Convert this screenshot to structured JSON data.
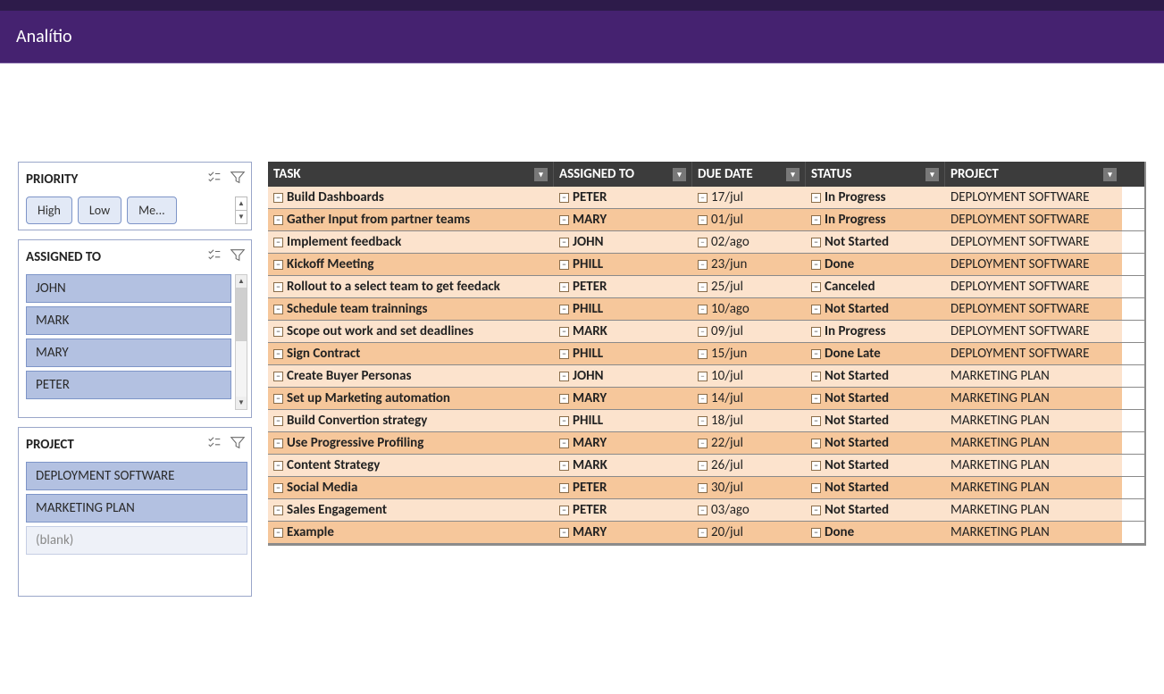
{
  "header": {
    "title": "Analítio"
  },
  "slicers": {
    "priority": {
      "title": "PRIORITY",
      "items": [
        "High",
        "Low",
        "Me..."
      ]
    },
    "assigned": {
      "title": "ASSIGNED TO",
      "items": [
        "JOHN",
        "MARK",
        "MARY",
        "PETER"
      ]
    },
    "project": {
      "title": "PROJECT",
      "items": [
        "DEPLOYMENT SOFTWARE",
        "MARKETING PLAN"
      ],
      "blank": "(blank)"
    }
  },
  "table": {
    "columns": [
      "TASK",
      "ASSIGNED TO",
      "DUE DATE",
      "STATUS",
      "PROJECT"
    ],
    "rows": [
      {
        "task": "Build Dashboards",
        "assigned": "PETER",
        "due": "17/jul",
        "status": "In Progress",
        "project": "DEPLOYMENT SOFTWARE"
      },
      {
        "task": "Gather Input from partner teams",
        "assigned": "MARY",
        "due": "01/jul",
        "status": "In Progress",
        "project": "DEPLOYMENT SOFTWARE"
      },
      {
        "task": "Implement feedback",
        "assigned": "JOHN",
        "due": "02/ago",
        "status": "Not Started",
        "project": "DEPLOYMENT SOFTWARE"
      },
      {
        "task": "Kickoff Meeting",
        "assigned": "PHILL",
        "due": "23/jun",
        "status": "Done",
        "project": "DEPLOYMENT SOFTWARE"
      },
      {
        "task": "Rollout to a select team to get feedack",
        "assigned": "PETER",
        "due": "25/jul",
        "status": "Canceled",
        "project": "DEPLOYMENT SOFTWARE"
      },
      {
        "task": "Schedule team trainnings",
        "assigned": "PHILL",
        "due": "10/ago",
        "status": "Not Started",
        "project": "DEPLOYMENT SOFTWARE"
      },
      {
        "task": "Scope out work and set deadlines",
        "assigned": "MARK",
        "due": "09/jul",
        "status": "In Progress",
        "project": "DEPLOYMENT SOFTWARE"
      },
      {
        "task": "Sign Contract",
        "assigned": "PHILL",
        "due": "15/jun",
        "status": "Done Late",
        "project": "DEPLOYMENT SOFTWARE"
      },
      {
        "task": "Create Buyer Personas",
        "assigned": "JOHN",
        "due": "10/jul",
        "status": "Not Started",
        "project": "MARKETING PLAN"
      },
      {
        "task": "Set up Marketing automation",
        "assigned": "MARY",
        "due": "14/jul",
        "status": "Not Started",
        "project": "MARKETING PLAN"
      },
      {
        "task": "Build Convertion strategy",
        "assigned": "PHILL",
        "due": "18/jul",
        "status": "Not Started",
        "project": "MARKETING PLAN"
      },
      {
        "task": "Use Progressive Profiling",
        "assigned": "MARY",
        "due": "22/jul",
        "status": "Not Started",
        "project": "MARKETING PLAN"
      },
      {
        "task": "Content Strategy",
        "assigned": "MARK",
        "due": "26/jul",
        "status": "Not Started",
        "project": "MARKETING PLAN"
      },
      {
        "task": "Social Media",
        "assigned": "PETER",
        "due": "30/jul",
        "status": "Not Started",
        "project": "MARKETING PLAN"
      },
      {
        "task": "Sales Engagement",
        "assigned": "PETER",
        "due": "03/ago",
        "status": "Not Started",
        "project": "MARKETING PLAN"
      },
      {
        "task": "Example",
        "assigned": "MARY",
        "due": "20/jul",
        "status": "Done",
        "project": "MARKETING PLAN"
      }
    ]
  }
}
